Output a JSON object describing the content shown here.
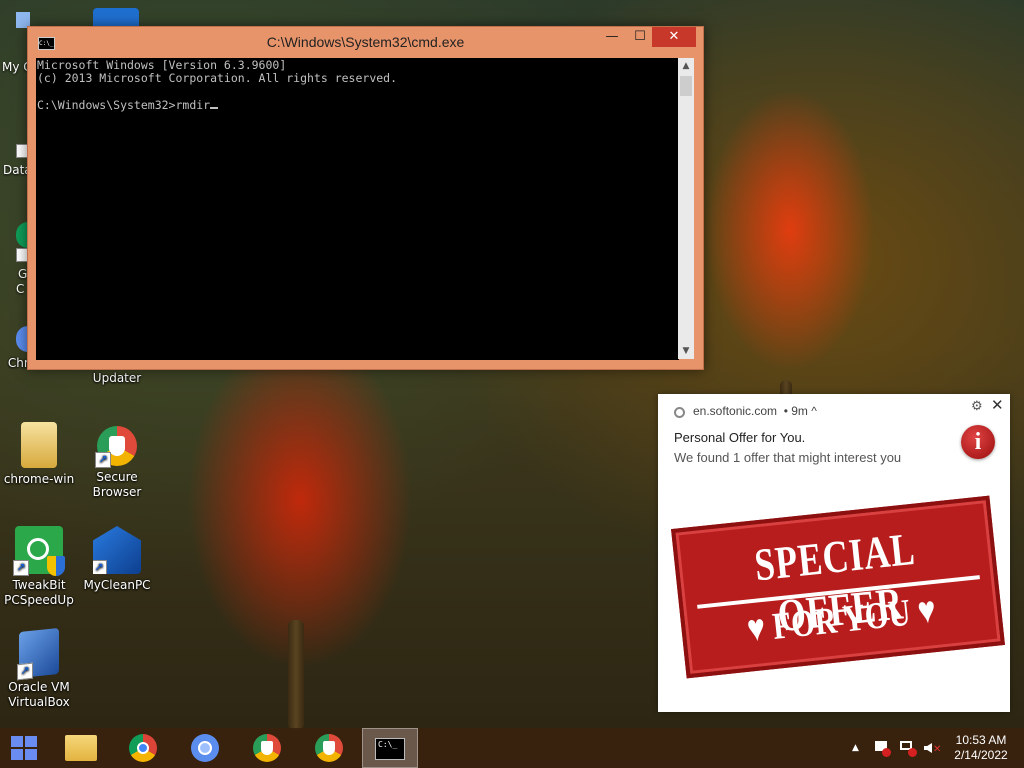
{
  "desktop": {
    "icons": [
      {
        "label": "Chromium"
      },
      {
        "label": "Bit Driver Updater"
      },
      {
        "label": "chrome-win"
      },
      {
        "label": "Secure Browser"
      },
      {
        "label": "TweakBit PCSpeedUp"
      },
      {
        "label": "MyCleanPC"
      },
      {
        "label": "Oracle VM VirtualBox"
      }
    ],
    "partial_labels": [
      "My C",
      "Data",
      "G",
      "C"
    ]
  },
  "cmd_window": {
    "title": "C:\\Windows\\System32\\cmd.exe",
    "system_icon_text": "C:\\_",
    "lines": [
      "Microsoft Windows [Version 6.3.9600]",
      "(c) 2013 Microsoft Corporation. All rights reserved.",
      "",
      "C:\\Windows\\System32>rmdir"
    ],
    "minimize_glyph": "—",
    "maximize_glyph": "☐",
    "close_glyph": "✕"
  },
  "notification": {
    "site": "en.softonic.com",
    "age": "• 9m ^",
    "title": "Personal Offer for You.",
    "body": "We found 1 offer that might interest you",
    "info_glyph": "i",
    "image_text_line1": "SPECIAL OFFER",
    "image_text_line2": "♥ FOR YOU ♥",
    "settings_glyph": "⚙",
    "close_glyph": "✕"
  },
  "taskbar": {
    "cmd_icon_text": "C:\\_",
    "tray_show_hidden": "▲",
    "clock_time": "10:53 AM",
    "clock_date": "2/14/2022"
  },
  "colors": {
    "cmd_frame": "#e8946a",
    "close_red": "#c7382b",
    "taskbar": "#3a220e",
    "start_blue": "#6a8cf0"
  }
}
